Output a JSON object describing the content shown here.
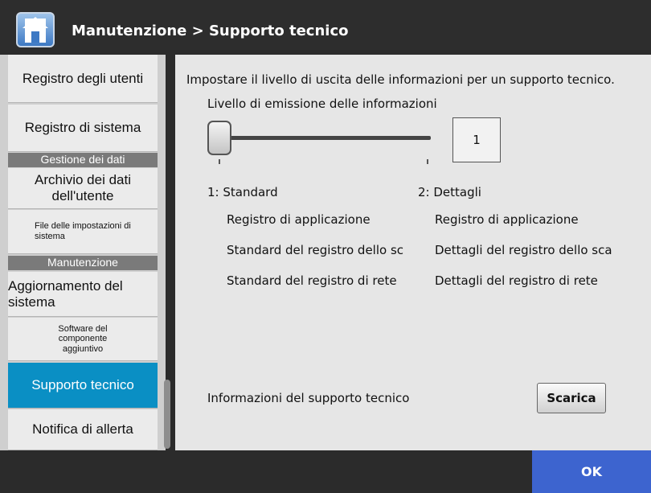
{
  "header": {
    "title": "Manutenzione > Supporto tecnico",
    "home_icon": "home-icon"
  },
  "sidebar": {
    "items": [
      {
        "label": "Registro degli utenti",
        "size": "big"
      },
      {
        "label": "Registro di sistema",
        "size": "big"
      },
      {
        "section": "Gestione dei dati"
      },
      {
        "label": "Archivio dei dati dell'utente",
        "size": "big"
      },
      {
        "label": "File delle impostazioni di sistema",
        "size": "small"
      },
      {
        "section": "Manutenzione"
      },
      {
        "label": "Aggiornamento del sistema",
        "size": "big"
      },
      {
        "label": "Software del componente aggiuntivo",
        "size": "small"
      },
      {
        "label": "Supporto tecnico",
        "size": "big",
        "active": true
      },
      {
        "label": "Notifica di allerta",
        "size": "big"
      }
    ]
  },
  "main": {
    "description": "Impostare il livello di uscita delle informazioni per un supporto tecnico.",
    "level_label": "Livello di emissione delle informazioni",
    "level_value": "1",
    "options": [
      {
        "title": "1: Standard",
        "rows": [
          "Registro di applicazione",
          "Standard del registro dello sc",
          "Standard del registro di rete"
        ]
      },
      {
        "title": "2: Dettagli",
        "rows": [
          "Registro di applicazione",
          "Dettagli del registro dello sca",
          "Dettagli del registro di rete"
        ]
      }
    ],
    "support_label": "Informazioni del supporto tecnico",
    "download_label": "Scarica"
  },
  "footer": {
    "ok_label": "OK"
  },
  "colors": {
    "active_item": "#0a8fc4",
    "ok_button": "#3d64cf",
    "section_header": "#7a7a7a"
  }
}
